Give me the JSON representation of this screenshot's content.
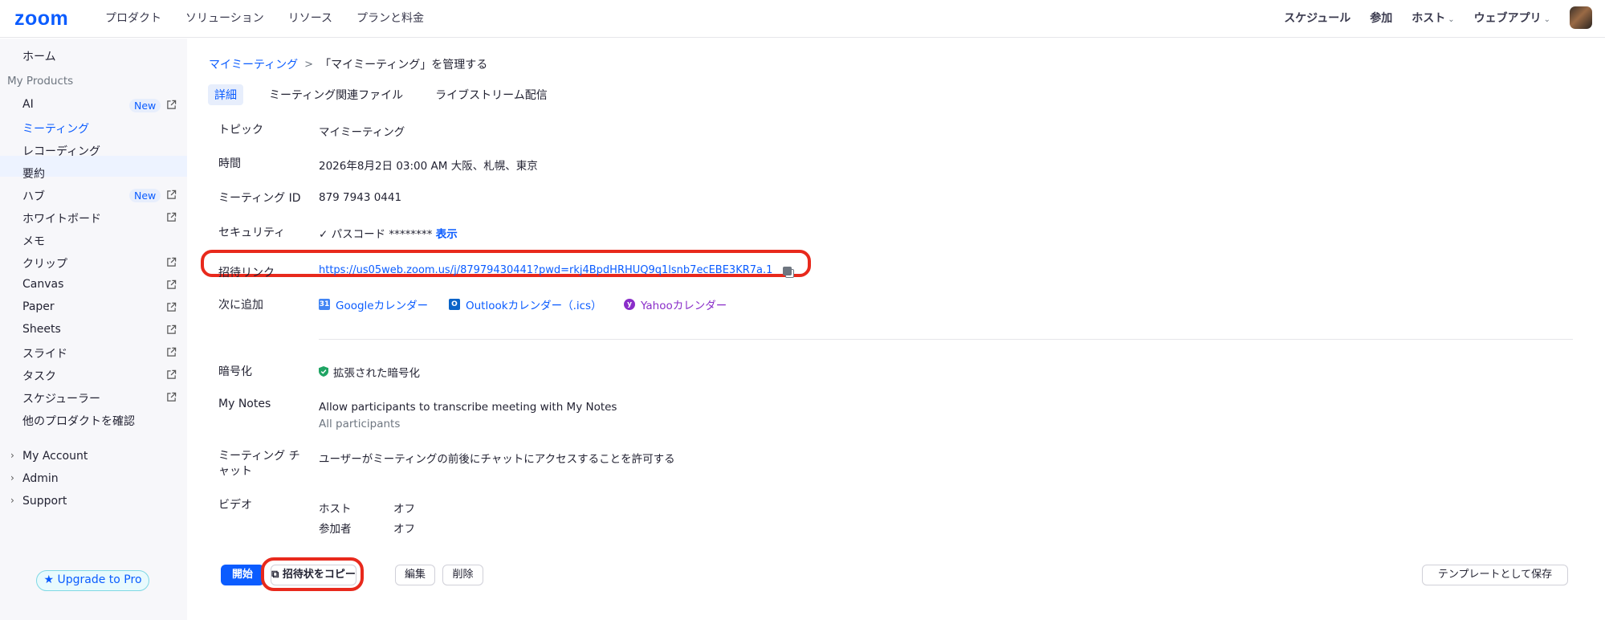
{
  "topnav": {
    "logo": "zoom",
    "left_links": [
      "プロダクト",
      "ソリューション",
      "リソース",
      "プランと料金"
    ],
    "right_links": [
      {
        "label": "スケジュール",
        "caret": false
      },
      {
        "label": "参加",
        "caret": false
      },
      {
        "label": "ホスト",
        "caret": true
      },
      {
        "label": "ウェブアプリ",
        "caret": true
      }
    ]
  },
  "sidebar": {
    "home": "ホーム",
    "my_products": "My Products",
    "items": [
      {
        "label": "AI",
        "badge": "New",
        "external": true
      },
      {
        "label": "ミーティング",
        "badge": "",
        "external": false,
        "active": true
      },
      {
        "label": "レコーディング",
        "badge": "",
        "external": false
      },
      {
        "label": "要約",
        "badge": "",
        "external": false
      },
      {
        "label": "ハブ",
        "badge": "New",
        "external": true
      },
      {
        "label": "ホワイトボード",
        "badge": "",
        "external": true
      },
      {
        "label": "メモ",
        "badge": "",
        "external": false
      },
      {
        "label": "クリップ",
        "badge": "",
        "external": true
      },
      {
        "label": "Canvas",
        "badge": "",
        "external": true
      },
      {
        "label": "Paper",
        "badge": "",
        "external": true
      },
      {
        "label": "Sheets",
        "badge": "",
        "external": true
      },
      {
        "label": "スライド",
        "badge": "",
        "external": true
      },
      {
        "label": "タスク",
        "badge": "",
        "external": true
      },
      {
        "label": "スケジューラー",
        "badge": "",
        "external": true
      },
      {
        "label": "他のプロダクトを確認",
        "badge": "",
        "external": false
      }
    ],
    "sections": [
      "My Account",
      "Admin",
      "Support"
    ],
    "upgrade": "Upgrade to Pro"
  },
  "breadcrumb": {
    "parent": "マイミーティング",
    "separator": ">",
    "current": "「マイミーティング」を管理する"
  },
  "tabs": [
    "詳細",
    "ミーティング関連ファイル",
    "ライブストリーム配信"
  ],
  "details": {
    "topic_label": "トピック",
    "topic": "マイミーティング",
    "time_label": "時間",
    "time": "2026年8月2日 03:00 AM 大阪、札幌、東京",
    "id_label": "ミーティング ID",
    "id": "879 7943 0441",
    "security_label": "セキュリティ",
    "security_check": "✓",
    "security_passcode": "パスコード",
    "security_mask": "********",
    "security_show": "表示",
    "invite_label": "招待リンク",
    "invite_link": "https://us05web.zoom.us/j/87979430441?pwd=rkj4BpdHRHUQ9q1lsnb7ecEBE3KR7a.1",
    "add_to_label": "次に追加",
    "google_cal": "Googleカレンダー",
    "outlook_cal": "Outlookカレンダー（.ics）",
    "yahoo_cal": "Yahooカレンダー",
    "encryption_label": "暗号化",
    "encryption": "拡張された暗号化",
    "notes_label": "My Notes",
    "notes_value": "Allow participants to transcribe meeting with My Notes",
    "notes_sub": "All participants",
    "chat_label_1": "ミーティング チ",
    "chat_label_2": "ャット",
    "chat_value": "ユーザーがミーティングの前後にチャットにアクセスすることを許可する",
    "video_label": "ビデオ",
    "video_host": "ホスト",
    "video_host_val": "オフ",
    "video_participant": "参加者",
    "video_participant_val": "オフ"
  },
  "actions": {
    "start": "開始",
    "copy_invite": "招待状をコピー",
    "edit": "編集",
    "delete": "削除",
    "save_template": "テンプレートとして保存"
  },
  "colors": {
    "accent": "#0b5cff",
    "highlight": "#e8291c",
    "encryption_shield": "#1fa463",
    "yahoo": "#8a2ec9"
  }
}
